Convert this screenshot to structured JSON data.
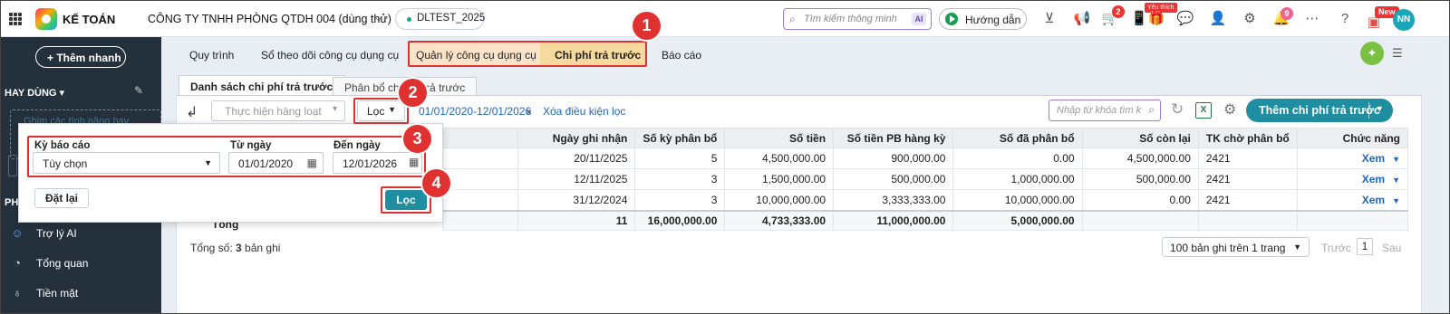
{
  "header": {
    "app_title": "KẾ TOÁN",
    "company": "CÔNG TY TNHH PHÒNG QTDH 004 (dùng thử)",
    "db_name": "DLTEST_2025",
    "search_placeholder": "Tìm kiếm thông minh",
    "ai_label": "AI",
    "guide_label": "Hướng dẫn",
    "badge_cart": "2",
    "badge_like": "Yêu thích",
    "badge_notify": "9",
    "badge_new": "New",
    "avatar_initials": "NN"
  },
  "sidebar": {
    "quick_add": "+ Thêm nhanh",
    "section_title": "HAY DÙNG",
    "section_caret": "▾",
    "dim_text": "Ghim các tính năng hay",
    "section2_stub": "PH",
    "items": [
      {
        "icon": "robot-icon",
        "label": "Trợ lý AI"
      },
      {
        "icon": "dashboard-icon",
        "label": "Tổng quan"
      },
      {
        "icon": "money-bag-icon",
        "label": "Tiền mặt"
      }
    ]
  },
  "tabs": [
    "Quy trình",
    "Sổ theo dõi công cụ dụng cụ",
    "Quản lý công cụ dụng cụ",
    "Chi phí trả trước",
    "Báo cáo"
  ],
  "subtabs": [
    "Danh sách chi phí trả trước",
    "Phân bổ chi phí trả trước"
  ],
  "toolbar": {
    "bulk_action": "Thực hiện hàng loạt",
    "filter": "Lọc",
    "date_range": "01/01/2020-12/01/2026",
    "clear_filter": "Xóa điều kiện lọc",
    "keyword_placeholder": "Nhập từ khóa tìm k",
    "add_button": "Thêm chi phí trả trước"
  },
  "filter_popup": {
    "period_label": "Kỳ báo cáo",
    "period_value": "Tùy chọn",
    "from_label": "Từ ngày",
    "from_value": "01/01/2020",
    "to_label": "Đến ngày",
    "to_value": "12/01/2026",
    "reset": "Đặt lại",
    "apply": "Lọc"
  },
  "table": {
    "headers": [
      "Ngày ghi nhận",
      "Số kỳ phân bổ",
      "Số tiền",
      "Số tiền PB hàng kỳ",
      "Số đã phân bổ",
      "Số còn lại",
      "TK chờ phân bổ",
      "Chức năng"
    ],
    "rows": [
      [
        "20/11/2025",
        "5",
        "4,500,000.00",
        "900,000.00",
        "0.00",
        "4,500,000.00",
        "2421",
        "Xem"
      ],
      [
        "12/11/2025",
        "3",
        "1,500,000.00",
        "500,000.00",
        "1,000,000.00",
        "500,000.00",
        "2421",
        "Xem"
      ],
      [
        "31/12/2024",
        "3",
        "10,000,000.00",
        "3,333,333.00",
        "10,000,000.00",
        "0.00",
        "2421",
        "Xem"
      ]
    ],
    "total_label": "Tổng",
    "totals": [
      "",
      "11",
      "16,000,000.00",
      "4,733,333.00",
      "11,000,000.00",
      "5,000,000.00",
      "",
      ""
    ]
  },
  "footer": {
    "total_prefix": "Tổng số: ",
    "total_count": "3",
    "total_suffix": " bản ghi",
    "page_size": "100 bản ghi trên 1 trang",
    "prev": "Trước",
    "page": "1",
    "next": "Sau"
  },
  "markers": [
    "1",
    "2",
    "3",
    "4"
  ],
  "colors": {
    "accent": "#1f8ea0",
    "highlight": "#e03131",
    "active_tab": "#f6d99c",
    "sidebar": "#24313d"
  }
}
